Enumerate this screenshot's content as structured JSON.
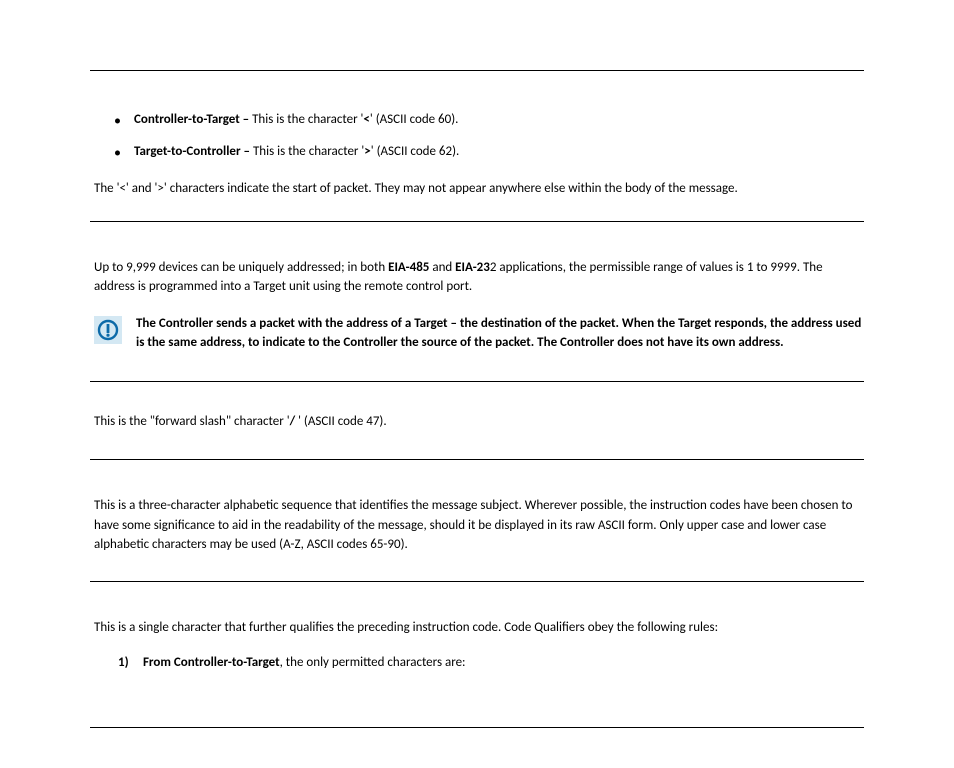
{
  "bullets": [
    {
      "label": "Controller-to-Target – ",
      "textA": "This is the character '",
      "char": "<",
      "textB": "' (ASCII code 60)."
    },
    {
      "label": "Target-to-Controller – ",
      "textA": "This is the character '",
      "char": ">",
      "textB": "' (ASCII code 62)."
    }
  ],
  "para1": "The '<' and '>' characters indicate the start of packet. They may not appear anywhere else within the body of the message.",
  "sec2": {
    "line1a": "Up to 9,999 devices can be uniquely addressed; in both ",
    "bold1": "EIA-485",
    "line1b": " and ",
    "bold2": "EIA-23",
    "line1c": "2 applications, the permissible range of values is 1 to 9999. The address is programmed into a Target unit using the remote control port.",
    "note": "The Controller sends a packet with the address of a Target – the destination of the packet. When the Target responds, the address used is the same address, to indicate to the Controller the source of the packet. The Controller does not have its own address."
  },
  "sec3": {
    "textA": "This is the \"forward slash\" character '",
    "char": "/",
    "textB": " ' (ASCII code 47)."
  },
  "sec4": "This is a three-character alphabetic sequence that identifies the message subject. Wherever possible, the instruction codes have been chosen to have some significance to aid in the readability of the message, should it be displayed in its raw ASCII form. Only upper case and lower case alphabetic characters may be used (A-Z, ASCII codes 65-90).",
  "sec5": {
    "intro": "This is a single character that further qualifies the preceding instruction code. Code Qualifiers obey the following rules:",
    "num": "1)",
    "bold": "From Controller-to-Target",
    "rest": ", the only permitted characters are:"
  }
}
